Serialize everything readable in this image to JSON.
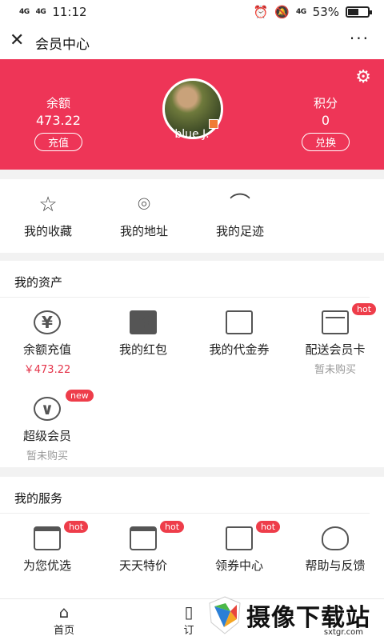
{
  "status_bar": {
    "signal_left": "4G",
    "signal_right": "4G",
    "time": "11:12",
    "right_signal": "4G",
    "battery_percent": "53%",
    "battery_level": 0.53
  },
  "nav": {
    "title": "会员中心",
    "more": "···"
  },
  "header": {
    "balance_label": "余额",
    "balance_value": "473.22",
    "recharge_label": "充值",
    "points_label": "积分",
    "points_value": "0",
    "exchange_label": "兑换",
    "username": "blue J."
  },
  "quick_links": [
    {
      "label": "我的收藏",
      "icon": "star-icon"
    },
    {
      "label": "我的地址",
      "icon": "location-pin-icon"
    },
    {
      "label": "我的足迹",
      "icon": "footprint-icon"
    }
  ],
  "assets": {
    "title": "我的资产",
    "items": [
      {
        "label": "余额充值",
        "sub": "￥473.22",
        "icon": "yen-circle-icon"
      },
      {
        "label": "我的红包",
        "icon": "red-envelope-icon"
      },
      {
        "label": "我的代金券",
        "icon": "voucher-icon"
      },
      {
        "label": "配送会员卡",
        "sub": "暂未购买",
        "tag": "hot",
        "icon": "card-icon"
      },
      {
        "label": "超级会员",
        "sub": "暂未购买",
        "tag": "new",
        "icon": "vip-icon"
      }
    ]
  },
  "services": {
    "title": "我的服务",
    "items": [
      {
        "label": "为您优选",
        "tag": "hot",
        "icon": "store-icon"
      },
      {
        "label": "天天特价",
        "tag": "hot",
        "icon": "store-icon"
      },
      {
        "label": "领券中心",
        "tag": "hot",
        "icon": "coupon-icon"
      },
      {
        "label": "帮助与反馈",
        "icon": "lightbulb-icon"
      }
    ]
  },
  "tabbar": {
    "home_label": "首页",
    "second_label": "订"
  },
  "watermark": {
    "name": "摄像下载站",
    "url": "sxtgr.com"
  }
}
